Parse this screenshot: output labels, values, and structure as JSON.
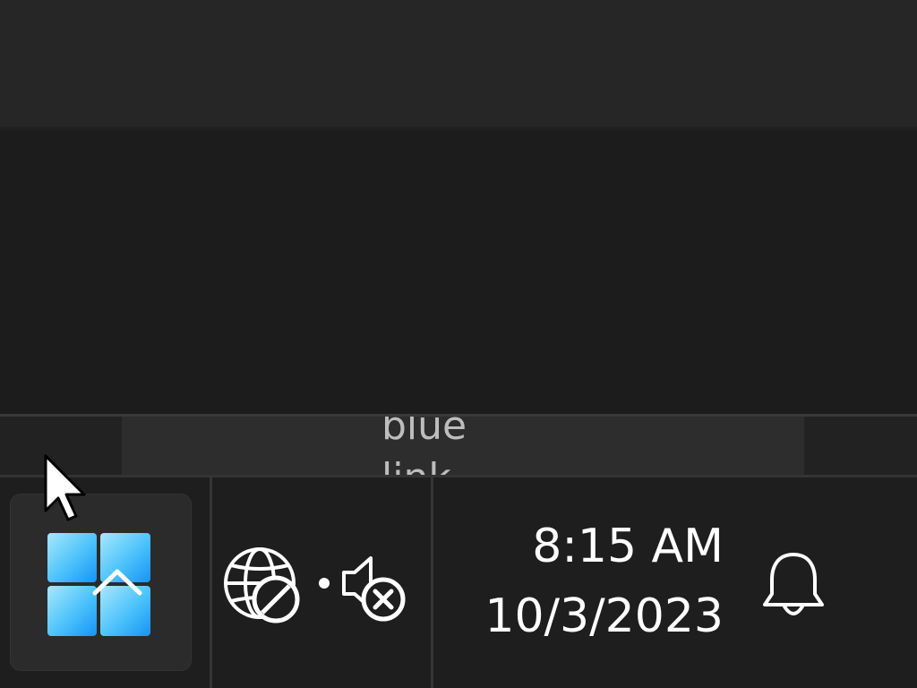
{
  "background_strip": {
    "text": "blue\nlink"
  },
  "taskbar": {
    "start_button": {
      "icon": "windows-logo-icon",
      "overlay_icon": "chevron-up-icon"
    },
    "tray": {
      "network_icon": "globe-no-internet-icon",
      "volume_icon": "volume-muted-icon"
    },
    "clock": {
      "time": "8:15 AM",
      "date": "10/3/2023"
    },
    "notifications_icon": "bell-icon"
  },
  "colors": {
    "taskbar_bg": "#1e1e1e",
    "start_button_bg": "#2b2b2b",
    "windows_logo_light": "#9fe3fb",
    "windows_logo_dark": "#1a9bf5",
    "text": "#ffffff"
  }
}
